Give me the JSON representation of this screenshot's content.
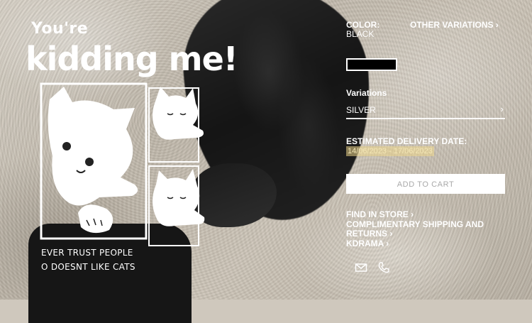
{
  "artwork": {
    "title_small": "You're",
    "title_big": "kidding me!",
    "caption_line1": "EVER TRUST PEOPLE",
    "caption_line2": "O DOESNT LIKE CATS"
  },
  "product": {
    "color_label": "COLOR:",
    "color_value": "BLACK",
    "other_variations": "OTHER VARIATIONS ›",
    "swatch_color": "#000000",
    "variations_label": "Variations",
    "variation_selected": "SILVER",
    "variation_chevron": "›",
    "delivery_label": "ESTIMATED DELIVERY DATE:",
    "delivery_dates": "14/06/2023 - 17/06/2023",
    "add_to_cart": "ADD TO CART",
    "links": {
      "find_in_store": "FIND IN STORE ›",
      "shipping": "COMPLIMENTARY SHIPPING AND RETURNS ›",
      "kdrama": "KDRAMA ›"
    },
    "icons": {
      "mail": "mail-icon",
      "phone": "phone-icon"
    }
  }
}
